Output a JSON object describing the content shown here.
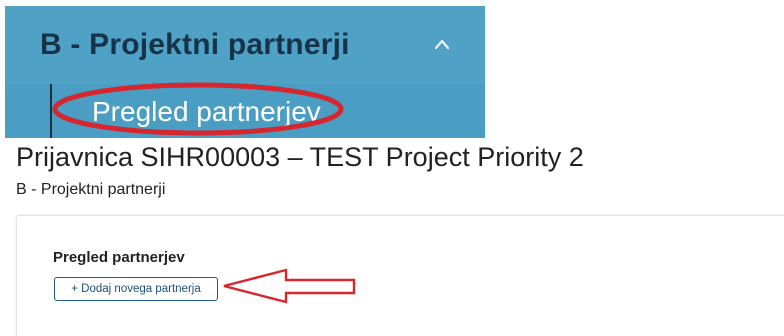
{
  "sidebar": {
    "section_title": "B - Projektni partnerji",
    "section_expanded": true,
    "sub_item_label": "Pregled partnerjev"
  },
  "page": {
    "title": "Prijavnica SIHR00003 – TEST Project Priority 2",
    "subtitle": "B - Projektni partnerji"
  },
  "card": {
    "heading": "Pregled partnerjev",
    "add_button_label": "+ Dodaj novega partnerja"
  },
  "colors": {
    "sidebar_background": "#4fa1c6",
    "sidebar_title_text": "#16334a",
    "highlight_annotation": "#d7262e",
    "button_border": "#1e5a8a"
  },
  "icons": {
    "collapse": "chevron-up-icon",
    "annotation": "arrow-left-icon"
  }
}
